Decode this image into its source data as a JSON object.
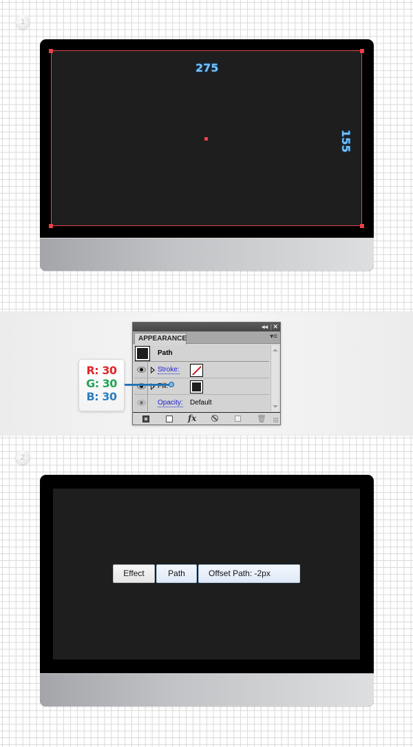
{
  "steps": [
    {
      "number": "1"
    },
    {
      "number": "2"
    }
  ],
  "step1": {
    "dimensions": {
      "width_label": "275",
      "height_label": "155"
    },
    "colors": {
      "bezel": "#000000",
      "screen": "#1e1e1e",
      "selection": "#e2474b",
      "dimension_text": "#78c1f5"
    }
  },
  "appearance_panel": {
    "title": "APPEARANCE",
    "collapse_icon": "◂◂",
    "close_icon": "✕",
    "menu_icon": "▾≡",
    "object_label": "Path",
    "rows": [
      {
        "label": "Stroke:",
        "swatch": "none",
        "has_expander": true,
        "linked": true
      },
      {
        "label": "Fill:",
        "swatch": "#1e1e1e",
        "has_expander": true,
        "linked": false
      },
      {
        "label": "Opacity:",
        "value": "Default",
        "linked": true
      }
    ],
    "footer_buttons": [
      "add-new-stroke",
      "add-new-fill",
      "add-new-effect",
      "clear-appearance",
      "duplicate-selected-item",
      "delete-selected-item"
    ],
    "fx_label": "fx"
  },
  "rgb_callout": {
    "r": "R: 30",
    "g": "G: 30",
    "b": "B: 30"
  },
  "step2": {
    "breadcrumb": [
      "Effect",
      "Path",
      "Offset Path: -2px"
    ]
  }
}
